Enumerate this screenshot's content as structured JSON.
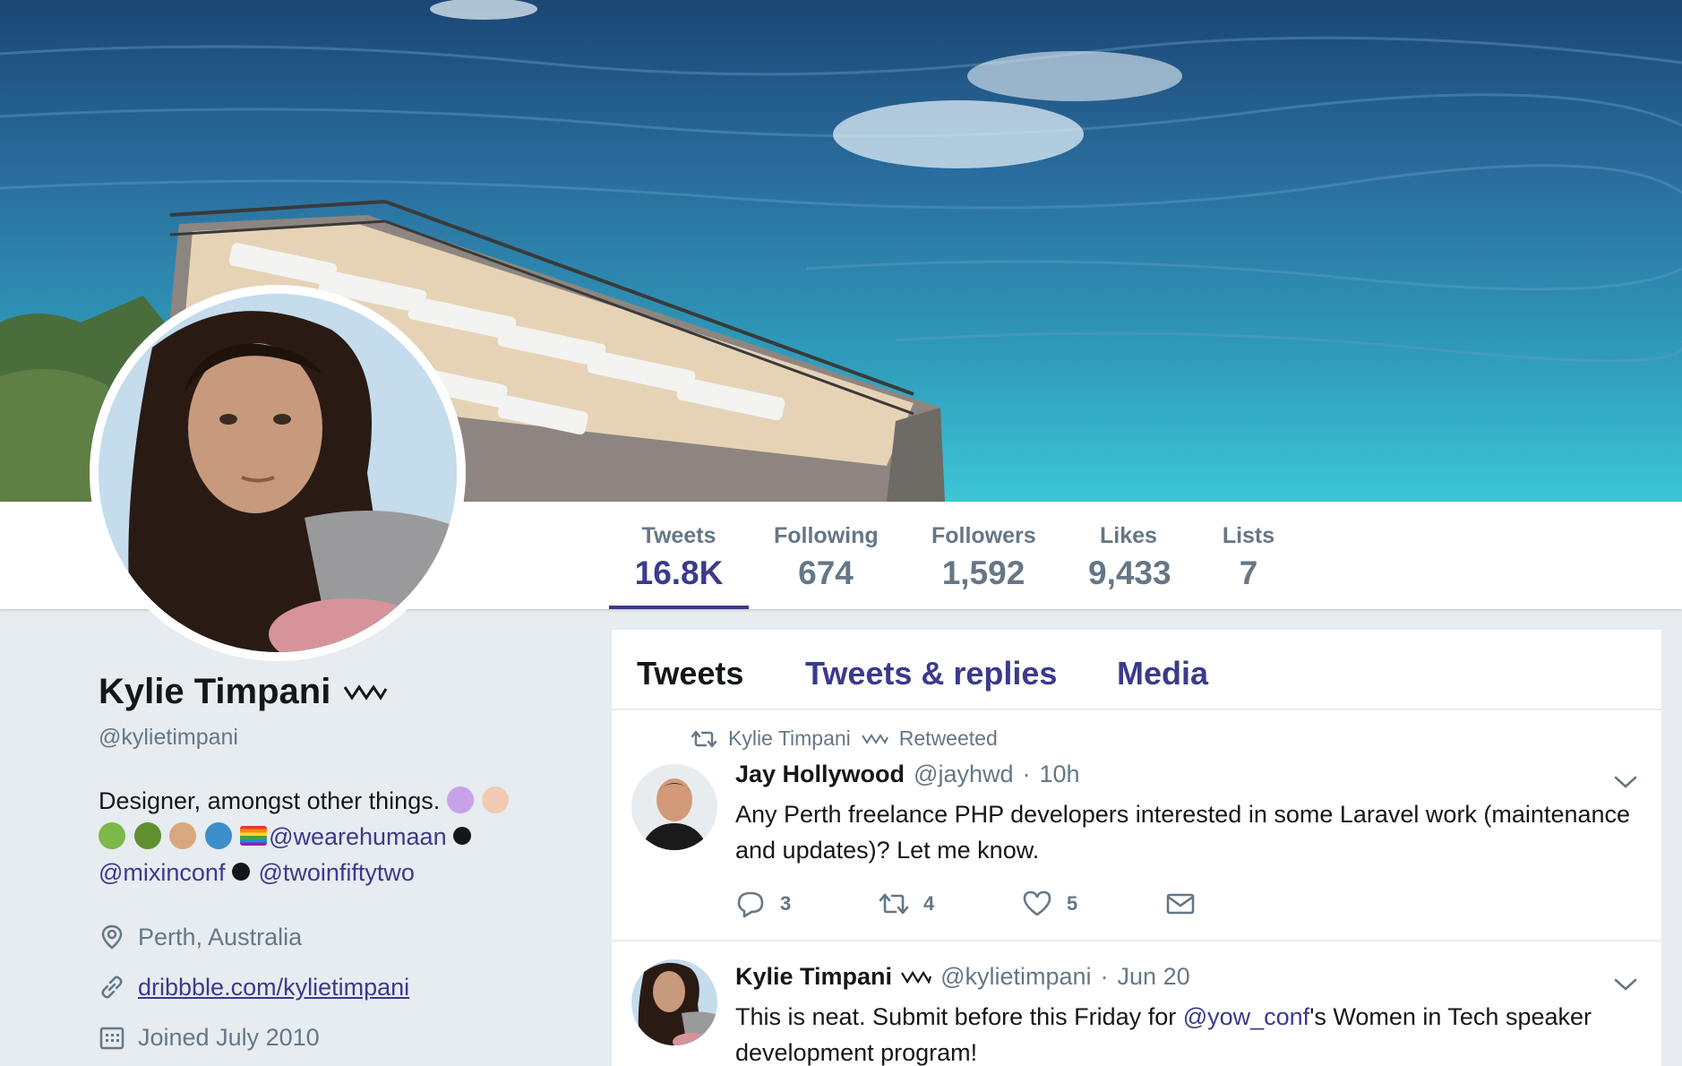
{
  "banner": {
    "description": "ocean"
  },
  "profile": {
    "name": "Kylie Timpani",
    "handle": "@kylietimpani",
    "bio_line1": "Designer, amongst other things.",
    "bio_mention1": "@wearehumaan",
    "bio_mention2": "@mixinconf",
    "bio_mention3": "@twoinfiftytwo",
    "location": "Perth, Australia",
    "website": "dribbble.com/kylietimpani",
    "joined": "Joined July 2010"
  },
  "stats": [
    {
      "label": "Tweets",
      "value": "16.8K"
    },
    {
      "label": "Following",
      "value": "674"
    },
    {
      "label": "Followers",
      "value": "1,592"
    },
    {
      "label": "Likes",
      "value": "9,433"
    },
    {
      "label": "Lists",
      "value": "7"
    }
  ],
  "tabs": [
    "Tweets",
    "Tweets & replies",
    "Media"
  ],
  "tweets": [
    {
      "retweeted_by": "Kylie Timpani",
      "retweeted_label": "Retweeted",
      "name": "Jay Hollywood",
      "handle": "@jayhwd",
      "dot": "·",
      "time": "10h",
      "text": "Any Perth freelance PHP developers interested in some Laravel work (maintenance and updates)? Let me know.",
      "replies": "3",
      "retweets": "4",
      "likes": "5"
    },
    {
      "name": "Kylie Timpani",
      "handle": "@kylietimpani",
      "dot": "·",
      "time": "Jun 20",
      "text_before": "This is neat. Submit before this Friday for ",
      "text_mention": "@yow_conf",
      "text_after": "'s Women in Tech speaker development program!"
    }
  ],
  "colors": {
    "accent": "#3b3a8c",
    "muted": "#657786",
    "background": "#e6ecf0"
  }
}
